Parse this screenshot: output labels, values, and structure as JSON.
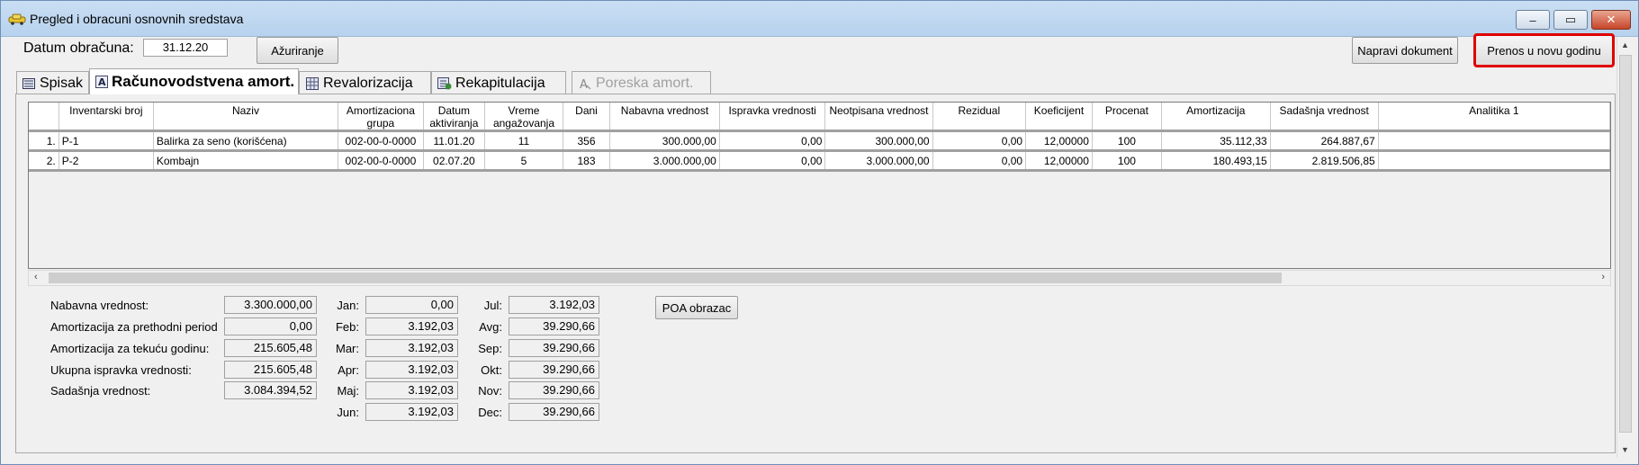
{
  "window": {
    "title": "Pregled i obracuni osnovnih sredstava",
    "controls": {
      "minimize": "‒",
      "maximize": "▭",
      "close": "✕"
    }
  },
  "toolbar": {
    "datum_label": "Datum obračuna:",
    "datum_value": "31.12.20",
    "azuriranje": "Ažuriranje",
    "napravi_dokument": "Napravi dokument",
    "prenos": "Prenos u novu godinu"
  },
  "tabs": [
    {
      "label": "Spisak",
      "icon": "list-icon"
    },
    {
      "label": "Računovodstvena amort.",
      "icon": "letter-a-icon"
    },
    {
      "label": "Revalorizacija",
      "icon": "grid-icon"
    },
    {
      "label": "Rekapitulacija",
      "icon": "recap-icon"
    },
    {
      "label": "Poreska amort.",
      "icon": "letter-a-disabled-icon"
    }
  ],
  "grid": {
    "headers": [
      "",
      "Inventarski broj",
      "Naziv",
      "Amortizaciona grupa",
      "Datum aktiviranja",
      "Vreme angažovanja",
      "Dani",
      "Nabavna vrednost",
      "Ispravka vrednosti",
      "Neotpisana vrednost",
      "Rezidual",
      "Koeficijent",
      "Procenat",
      "Amortizacija",
      "Sadašnja vrednost",
      "Analitika 1"
    ],
    "rows": [
      [
        "1.",
        "P-1",
        "Balirka za seno (korišćena)",
        "002-00-0-0000",
        "11.01.20",
        "11",
        "356",
        "300.000,00",
        "0,00",
        "300.000,00",
        "0,00",
        "12,00000",
        "100",
        "35.112,33",
        "264.887,67",
        ""
      ],
      [
        "2.",
        "P-2",
        "Kombajn",
        "002-00-0-0000",
        "02.07.20",
        "5",
        "183",
        "3.000.000,00",
        "0,00",
        "3.000.000,00",
        "0,00",
        "12,00000",
        "100",
        "180.493,15",
        "2.819.506,85",
        ""
      ]
    ]
  },
  "summary": {
    "nabavna_label": "Nabavna vrednost:",
    "nabavna_value": "3.300.000,00",
    "amort_pret_label": "Amortizacija za prethodni period",
    "amort_pret_value": "0,00",
    "amort_tek_label": "Amortizacija za tekuću godinu:",
    "amort_tek_value": "215.605,48",
    "ukupna_label": "Ukupna ispravka vrednosti:",
    "ukupna_value": "215.605,48",
    "sadasnja_label": "Sadašnja vrednost:",
    "sadasnja_value": "3.084.394,52"
  },
  "months_left": [
    {
      "label": "Jan:",
      "value": "0,00"
    },
    {
      "label": "Feb:",
      "value": "3.192,03"
    },
    {
      "label": "Mar:",
      "value": "3.192,03"
    },
    {
      "label": "Apr:",
      "value": "3.192,03"
    },
    {
      "label": "Maj:",
      "value": "3.192,03"
    },
    {
      "label": "Jun:",
      "value": "3.192,03"
    }
  ],
  "months_right": [
    {
      "label": "Jul:",
      "value": "3.192,03"
    },
    {
      "label": "Avg:",
      "value": "39.290,66"
    },
    {
      "label": "Sep:",
      "value": "39.290,66"
    },
    {
      "label": "Okt:",
      "value": "39.290,66"
    },
    {
      "label": "Nov:",
      "value": "39.290,66"
    },
    {
      "label": "Dec:",
      "value": "39.290,66"
    }
  ],
  "poa_button": "POA obrazac"
}
